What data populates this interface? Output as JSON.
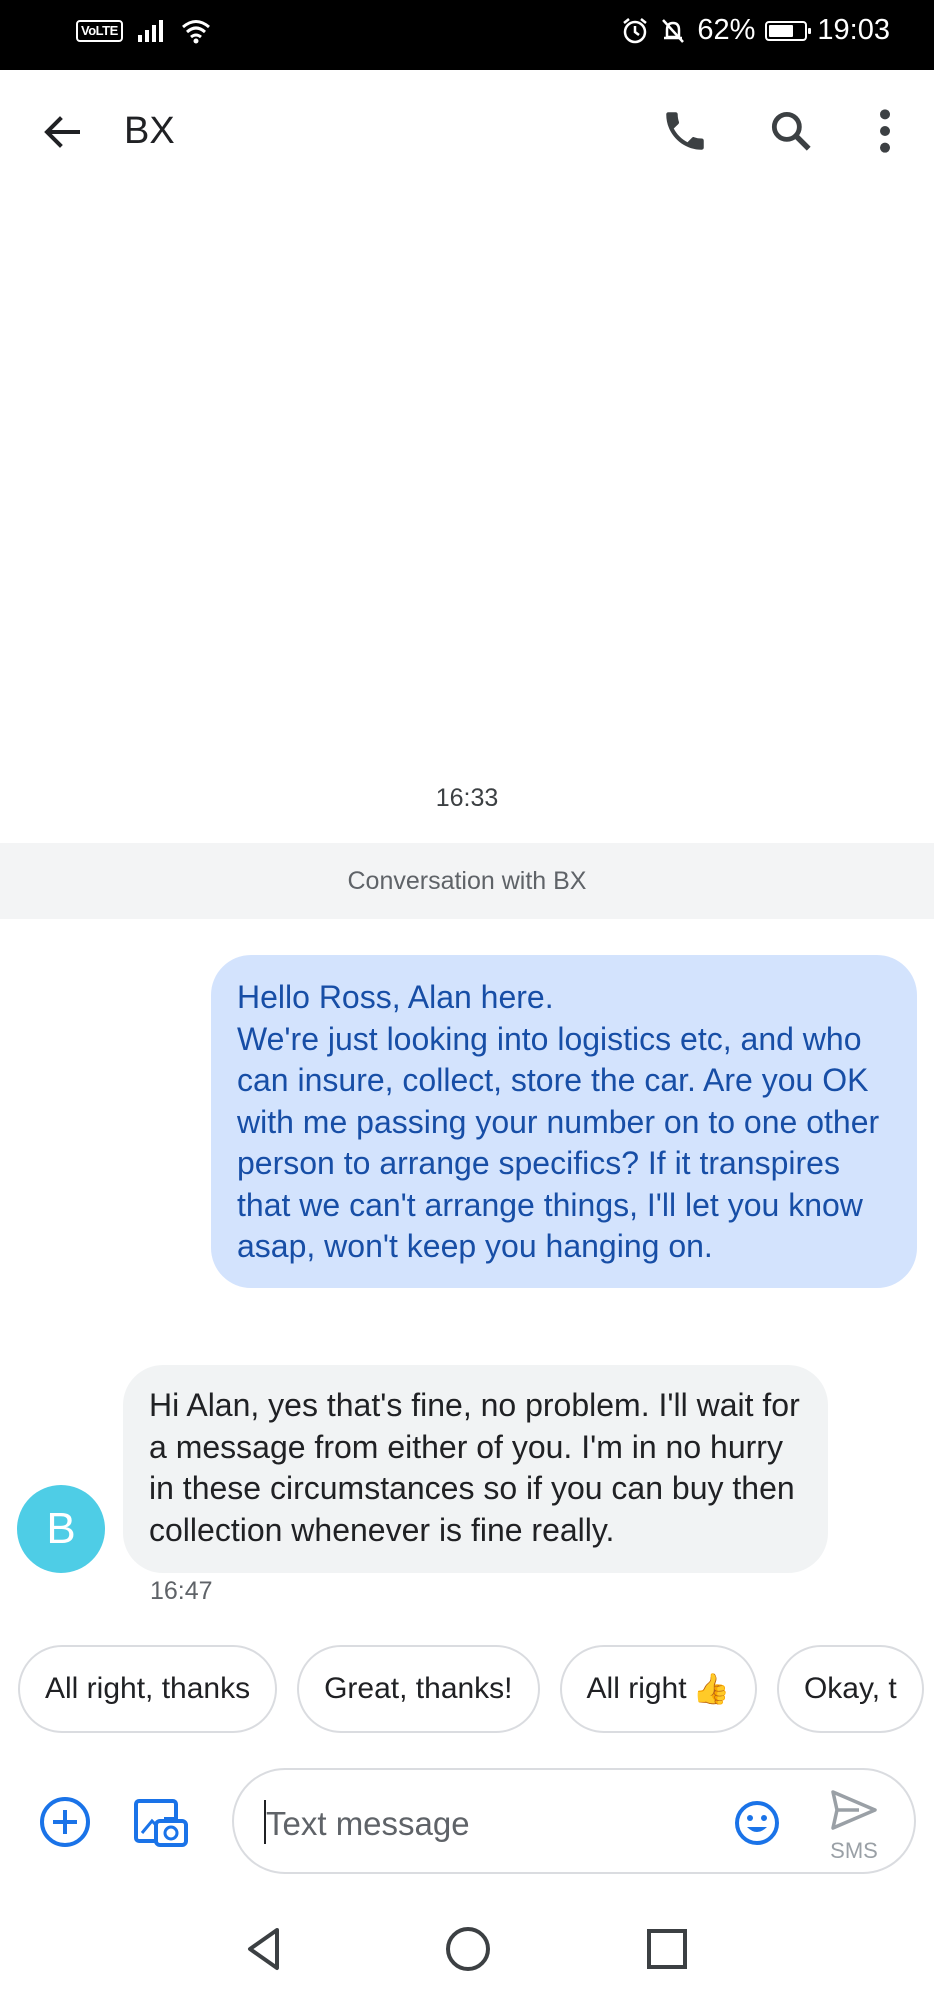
{
  "status_bar": {
    "volte": "VoLTE",
    "battery": "62%",
    "time": "19:03"
  },
  "header": {
    "title": "BX"
  },
  "conversation": {
    "timestamp": "16:33",
    "banner": "Conversation with BX",
    "outgoing": "Hello Ross, Alan here.\nWe're just looking into logistics etc, and who can insure, collect, store the car. Are you OK with me passing your number on to one other person to arrange specifics? If it transpires that we can't arrange things, I'll let you know asap, won't keep you hanging on.",
    "incoming": "Hi Alan, yes that's fine, no problem. I'll wait for a message from either of you. I'm in no hurry in these circumstances so if you can buy then collection whenever is fine really.",
    "incoming_time": "16:47",
    "avatar_letter": "B"
  },
  "smart_replies": [
    "All right, thanks",
    "Great, thanks!",
    "All right",
    "Okay, t"
  ],
  "smart_reply_emoji": "👍",
  "compose": {
    "placeholder": "Text message",
    "send_label": "SMS"
  }
}
